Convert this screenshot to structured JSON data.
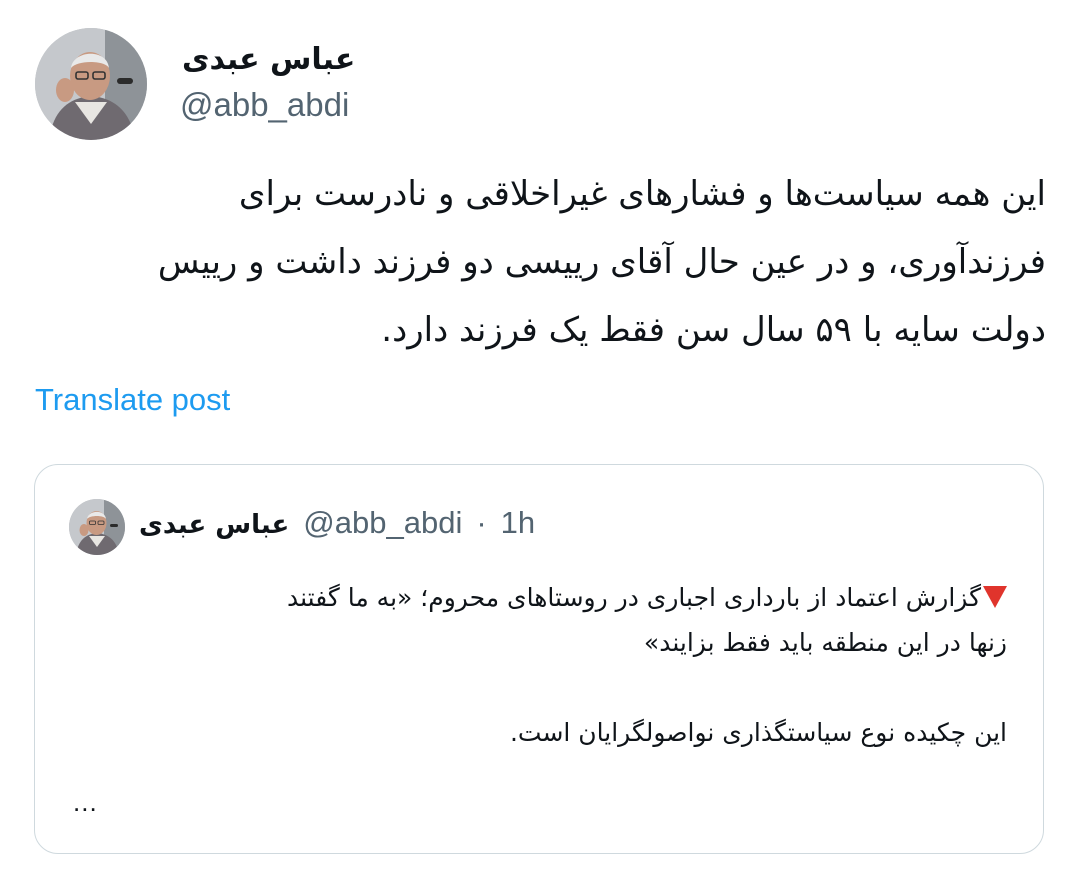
{
  "post": {
    "author_name": "عباس عبدی",
    "author_handle": "@abb_abdi",
    "text_lines": [
      "این همه سیاست‌ها و فشارهای غیراخلاقی و نادرست برای",
      "فرزندآوری، و در عین حال آقای رییسی دو فرزند داشت و رییس",
      "دولت سایه با ۵۹ سال سن فقط یک فرزند دارد."
    ],
    "translate_label": "Translate post"
  },
  "quoted_post": {
    "author_name": "عباس عبدی",
    "author_handle": "@abb_abdi",
    "separator": "·",
    "time": "1h",
    "marker_icon": "red-triangle-down-icon",
    "text_lines": [
      "گزارش اعتماد از بارداری اجباری در روستاهای محروم؛ «به ما گفتند",
      "زنها در این منطقه باید فقط بزایند»",
      "",
      "این چکیده نوع سیاستگذاری نواصولگرایان است."
    ],
    "ellipsis": "..."
  },
  "colors": {
    "text_primary": "#0f1419",
    "text_secondary": "#536471",
    "link": "#1d9bf0",
    "border": "#cfd9de",
    "marker": "#e0342c"
  }
}
